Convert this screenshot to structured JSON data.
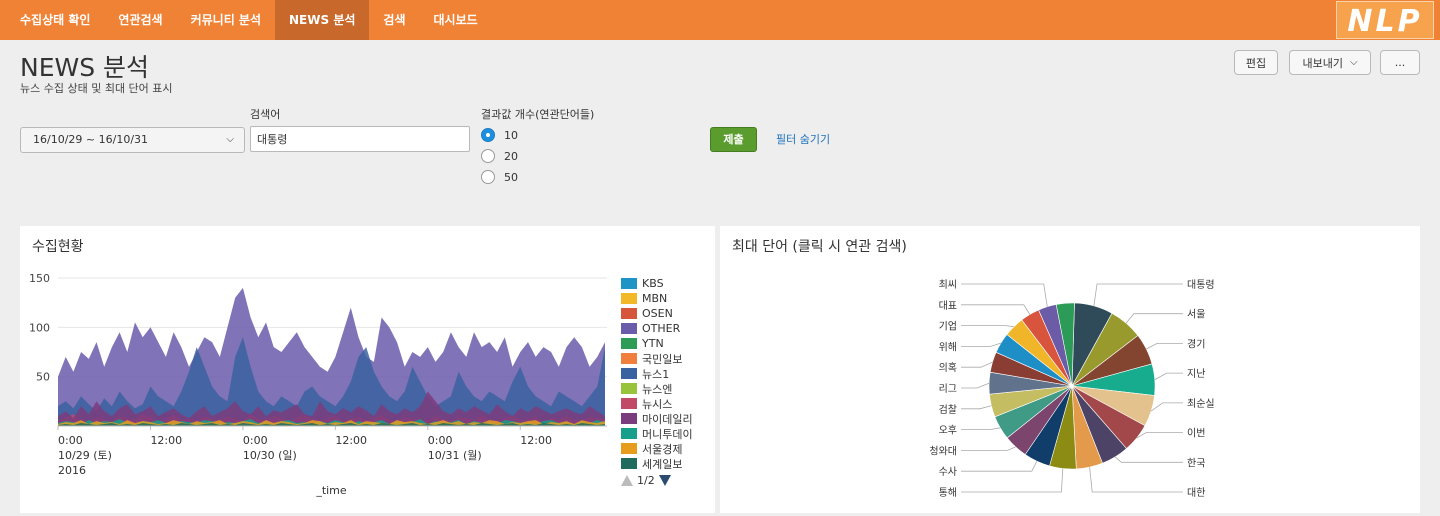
{
  "nav": {
    "items": [
      {
        "label": "수집상태 확인"
      },
      {
        "label": "연관검색"
      },
      {
        "label": "커뮤니티 분석"
      },
      {
        "label": "NEWS 분석",
        "active": true
      },
      {
        "label": "검색"
      },
      {
        "label": "대시보드"
      }
    ],
    "logo_text": "NLP"
  },
  "header": {
    "title": "NEWS 분석",
    "subtitle": "뉴스 수집 상태 및 최대 단어 표시",
    "edit_label": "편집",
    "export_label": "내보내기",
    "more_label": "..."
  },
  "filters": {
    "date_range": "16/10/29 ~ 16/10/31",
    "search_label": "검색어",
    "search_value": "대통령",
    "result_count_label": "결과값 개수(연관단어들)",
    "result_options": [
      "10",
      "20",
      "50"
    ],
    "result_selected": "10",
    "submit_label": "제출",
    "hide_filter_label": "필터 숨기기"
  },
  "collection_panel": {
    "title": "수집현황",
    "legend_page": "1/2"
  },
  "word_panel": {
    "title": "최대 단어 (클릭 시 연관 검색)"
  },
  "chart_data": [
    {
      "type": "area",
      "x": [
        "2016-10-29 00:00",
        "2016-10-29 12:00",
        "2016-10-30 00:00",
        "2016-10-30 12:00",
        "2016-10-31 00:00",
        "2016-10-31 12:00"
      ],
      "x_tick_labels": [
        {
          "lines": [
            "0:00",
            "10/29 (토)",
            "2016"
          ]
        },
        {
          "lines": [
            "12:00"
          ]
        },
        {
          "lines": [
            "0:00",
            "10/30 (일)"
          ]
        },
        {
          "lines": [
            "12:00"
          ]
        },
        {
          "lines": [
            "0:00",
            "10/31 (월)"
          ]
        },
        {
          "lines": [
            "12:00"
          ]
        }
      ],
      "xlabel": "_time",
      "ylabel": "",
      "ylim": [
        0,
        150
      ],
      "y_ticks": [
        50,
        100,
        150
      ],
      "grid": true,
      "legend_position": "right",
      "hours": 72,
      "series": [
        {
          "name": "KBS",
          "color": "#1e93c6",
          "values": [
            6,
            3,
            8,
            2,
            5,
            10,
            4,
            3,
            7,
            2,
            6,
            9,
            3,
            5,
            8,
            4,
            2,
            6,
            11,
            3,
            4,
            7,
            2,
            5,
            9,
            3,
            6,
            4,
            8,
            2,
            5,
            7,
            3,
            6,
            4,
            2,
            8,
            5,
            3,
            6,
            10,
            2,
            4,
            7,
            3,
            5,
            8,
            2,
            6,
            4,
            9,
            3,
            5,
            2,
            7,
            4,
            6,
            3,
            8,
            2,
            5,
            7,
            3,
            4,
            6,
            2,
            8,
            5,
            3,
            6,
            4,
            2
          ]
        },
        {
          "name": "MBN",
          "color": "#f2b827",
          "values": [
            3,
            5,
            2,
            7,
            4,
            2,
            6,
            3,
            8,
            4,
            2,
            5,
            7,
            3,
            4,
            6,
            2,
            8,
            3,
            5,
            4,
            2,
            6,
            7,
            3,
            4,
            2,
            9,
            5,
            3,
            6,
            2,
            4,
            7,
            3,
            5,
            2,
            6,
            4,
            3,
            7,
            5,
            2,
            4,
            6,
            3,
            2,
            8,
            4,
            5,
            3,
            6,
            2,
            4,
            7,
            3,
            5,
            2,
            6,
            4,
            3,
            8,
            2,
            5,
            4,
            3,
            6,
            2,
            7,
            4,
            3,
            5
          ]
        },
        {
          "name": "OSEN",
          "color": "#d6563c",
          "values": [
            8,
            4,
            12,
            6,
            3,
            15,
            5,
            9,
            4,
            7,
            13,
            5,
            3,
            8,
            18,
            6,
            4,
            9,
            5,
            12,
            7,
            3,
            6,
            10,
            4,
            8,
            5,
            3,
            14,
            6,
            9,
            4,
            7,
            5,
            11,
            3,
            6,
            8,
            4,
            19,
            6,
            5,
            8,
            4,
            12,
            7,
            3,
            6,
            9,
            5,
            4,
            10,
            6,
            3,
            8,
            5,
            12,
            4,
            7,
            3,
            6,
            9,
            5,
            4,
            7,
            11,
            3,
            6,
            8,
            4,
            5,
            7
          ]
        },
        {
          "name": "OTHER",
          "color": "#6a5bab",
          "values": [
            50,
            70,
            55,
            75,
            68,
            85,
            60,
            80,
            95,
            75,
            105,
            90,
            100,
            85,
            70,
            95,
            80,
            60,
            75,
            90,
            85,
            70,
            100,
            130,
            140,
            110,
            90,
            105,
            80,
            75,
            85,
            95,
            80,
            70,
            60,
            55,
            70,
            95,
            120,
            90,
            70,
            65,
            110,
            100,
            85,
            60,
            75,
            70,
            80,
            65,
            75,
            95,
            80,
            70,
            95,
            80,
            85,
            75,
            90,
            60,
            75,
            85,
            70,
            80,
            75,
            60,
            80,
            90,
            80,
            60,
            70,
            85
          ]
        },
        {
          "name": "YTN",
          "color": "#2e9c57",
          "values": [
            2,
            1,
            3,
            1,
            2,
            4,
            1,
            2,
            1,
            3,
            2,
            1,
            4,
            2,
            1,
            3,
            2,
            1,
            2,
            3,
            1,
            2,
            4,
            1,
            2,
            3,
            1,
            2,
            1,
            3,
            2,
            4,
            1,
            2,
            3,
            1,
            2,
            1,
            3,
            2,
            1,
            4,
            2,
            1,
            3,
            2,
            1,
            2,
            3,
            1,
            2,
            4,
            1,
            3,
            2,
            1,
            2,
            3,
            1,
            2,
            4,
            1,
            2,
            3,
            1,
            2,
            1,
            3,
            2,
            1,
            4,
            2
          ]
        },
        {
          "name": "국민일보",
          "color": "#f07e3c",
          "values": [
            4,
            2,
            6,
            3,
            10,
            5,
            2,
            4,
            7,
            3,
            14,
            5,
            2,
            6,
            3,
            4,
            8,
            2,
            5,
            3,
            6,
            9,
            2,
            4,
            3,
            7,
            2,
            5,
            4,
            12,
            3,
            6,
            2,
            4,
            5,
            3,
            7,
            2,
            6,
            4,
            3,
            5,
            2,
            8,
            4,
            3,
            6,
            2,
            5,
            4,
            7,
            3,
            2,
            6,
            4,
            3,
            5,
            8,
            2,
            4,
            3,
            6,
            2,
            5,
            4,
            3,
            7,
            2,
            5,
            3,
            4,
            6
          ]
        },
        {
          "name": "뉴스1",
          "color": "#3b62a0",
          "values": [
            20,
            25,
            18,
            30,
            22,
            15,
            28,
            20,
            35,
            25,
            18,
            22,
            40,
            30,
            25,
            20,
            35,
            55,
            80,
            60,
            40,
            30,
            25,
            70,
            90,
            60,
            35,
            25,
            20,
            30,
            25,
            20,
            35,
            40,
            30,
            25,
            20,
            30,
            45,
            70,
            80,
            55,
            40,
            30,
            25,
            35,
            60,
            45,
            30,
            20,
            25,
            30,
            55,
            40,
            30,
            25,
            35,
            30,
            25,
            45,
            60,
            40,
            30,
            25,
            20,
            35,
            30,
            25,
            20,
            30,
            40,
            80
          ]
        },
        {
          "name": "뉴스엔",
          "color": "#98c43b",
          "values": [
            2,
            4,
            3,
            5,
            2,
            6,
            3,
            4,
            2,
            5,
            3,
            2,
            4,
            6,
            3,
            5,
            2,
            4,
            3,
            6,
            2,
            4,
            5,
            3,
            2,
            6,
            4,
            3,
            5,
            2,
            4,
            3,
            6,
            2,
            5,
            3,
            4,
            2,
            6,
            3,
            5,
            4,
            2,
            3,
            6,
            4,
            2,
            5,
            3,
            4,
            2,
            6,
            3,
            5,
            4,
            2,
            3,
            5,
            4,
            2,
            6,
            3,
            4,
            5,
            2,
            3,
            6,
            4,
            2,
            5,
            3,
            4
          ]
        },
        {
          "name": "뉴시스",
          "color": "#c34a66",
          "values": [
            5,
            8,
            12,
            6,
            4,
            9,
            7,
            5,
            10,
            8,
            6,
            12,
            9,
            5,
            7,
            11,
            6,
            8,
            5,
            10,
            7,
            6,
            9,
            8,
            5,
            12,
            7,
            6,
            10,
            8,
            5,
            9,
            12,
            7,
            6,
            8,
            10,
            5,
            7,
            9,
            6,
            8,
            11,
            6,
            5,
            9,
            7,
            8,
            6,
            10,
            7,
            5,
            9,
            8,
            6,
            11,
            7,
            5,
            8,
            10,
            6,
            7,
            9,
            5,
            8,
            7,
            10,
            6,
            5,
            9,
            8,
            7
          ]
        },
        {
          "name": "마이데일리",
          "color": "#7b3c7e",
          "values": [
            10,
            15,
            8,
            20,
            12,
            25,
            15,
            10,
            18,
            22,
            12,
            15,
            20,
            10,
            14,
            18,
            12,
            8,
            15,
            20,
            10,
            14,
            18,
            25,
            15,
            12,
            20,
            10,
            16,
            14,
            18,
            22,
            12,
            10,
            25,
            15,
            12,
            18,
            14,
            20,
            16,
            10,
            22,
            15,
            12,
            18,
            14,
            20,
            35,
            25,
            15,
            12,
            18,
            14,
            20,
            16,
            12,
            22,
            15,
            10,
            18,
            14,
            20,
            16,
            12,
            15,
            18,
            14,
            12,
            20,
            15,
            10
          ]
        },
        {
          "name": "머니투데이",
          "color": "#16a08b",
          "values": [
            3,
            5,
            4,
            2,
            6,
            3,
            5,
            4,
            7,
            3,
            2,
            5,
            4,
            6,
            3,
            2,
            5,
            4,
            3,
            6,
            5,
            2,
            4,
            3,
            5,
            7,
            3,
            4,
            2,
            5,
            6,
            3,
            4,
            2,
            5,
            3,
            6,
            4,
            2,
            5,
            3,
            4,
            6,
            2,
            5,
            3,
            4,
            7,
            2,
            5,
            3,
            4,
            6,
            2,
            5,
            3,
            4,
            2,
            6,
            5,
            3,
            4,
            2,
            5,
            6,
            3,
            4,
            2,
            5,
            3,
            6,
            4
          ]
        },
        {
          "name": "서울경제",
          "color": "#e69d1e",
          "values": [
            2,
            4,
            3,
            6,
            2,
            5,
            3,
            4,
            2,
            6,
            3,
            5,
            4,
            2,
            3,
            6,
            4,
            2,
            5,
            3,
            4,
            6,
            2,
            3,
            5,
            4,
            2,
            6,
            3,
            5,
            4,
            2,
            3,
            6,
            5,
            2,
            4,
            3,
            6,
            2,
            5,
            4,
            3,
            2,
            6,
            4,
            5,
            3,
            2,
            4,
            6,
            3,
            5,
            2,
            4,
            3,
            6,
            5,
            2,
            4,
            3,
            5,
            6,
            2,
            4,
            3,
            5,
            2,
            6,
            4,
            3,
            5
          ]
        },
        {
          "name": "세계일보",
          "color": "#1f6b5e",
          "values": [
            1,
            2,
            1,
            3,
            2,
            1,
            2,
            3,
            1,
            2,
            1,
            3,
            2,
            1,
            2,
            1,
            3,
            2,
            1,
            2,
            3,
            1,
            2,
            1,
            3,
            2,
            1,
            2,
            1,
            3,
            2,
            1,
            2,
            3,
            1,
            2,
            1,
            2,
            3,
            1,
            2,
            1,
            3,
            2,
            1,
            2,
            3,
            1,
            2,
            1,
            3,
            2,
            1,
            2,
            1,
            3,
            2,
            1,
            2,
            3,
            1,
            2,
            1,
            3,
            2,
            1,
            2,
            1,
            3,
            2,
            1,
            2
          ]
        }
      ]
    },
    {
      "type": "pie",
      "title": "최대 단어 (클릭 시 연관 검색)",
      "slices": [
        {
          "label": "대통령",
          "value": 6.4,
          "color": "#2f4a58"
        },
        {
          "label": "서울",
          "value": 5.6,
          "color": "#989a2e"
        },
        {
          "label": "경기",
          "value": 5.2,
          "color": "#83452f"
        },
        {
          "label": "지난",
          "value": 5.2,
          "color": "#16ac8d"
        },
        {
          "label": "최순실",
          "value": 5.2,
          "color": "#e3c28e"
        },
        {
          "label": "이번",
          "value": 4.8,
          "color": "#a2484a"
        },
        {
          "label": "한국",
          "value": 4.6,
          "color": "#4d4367"
        },
        {
          "label": "대한",
          "value": 4.4,
          "color": "#e39b4b"
        },
        {
          "label": "통해",
          "value": 4.4,
          "color": "#8c8b14"
        },
        {
          "label": "수사",
          "value": 4.4,
          "color": "#113d6b"
        },
        {
          "label": "청와대",
          "value": 4.0,
          "color": "#7c456d"
        },
        {
          "label": "오후",
          "value": 4.0,
          "color": "#3f9a86"
        },
        {
          "label": "검찰",
          "value": 3.8,
          "color": "#c5bd61"
        },
        {
          "label": "리그",
          "value": 3.6,
          "color": "#61728c"
        },
        {
          "label": "의혹",
          "value": 3.4,
          "color": "#8a3e33"
        },
        {
          "label": "위해",
          "value": 3.4,
          "color": "#1e8fc6"
        },
        {
          "label": "기업",
          "value": 3.4,
          "color": "#f1b52a"
        },
        {
          "label": "대표",
          "value": 3.2,
          "color": "#d8543c"
        },
        {
          "label": "최씨",
          "value": 3.0,
          "color": "#6c5ba7"
        },
        {
          "label": "",
          "value": 3.0,
          "color": "#2d9b58"
        }
      ]
    }
  ]
}
